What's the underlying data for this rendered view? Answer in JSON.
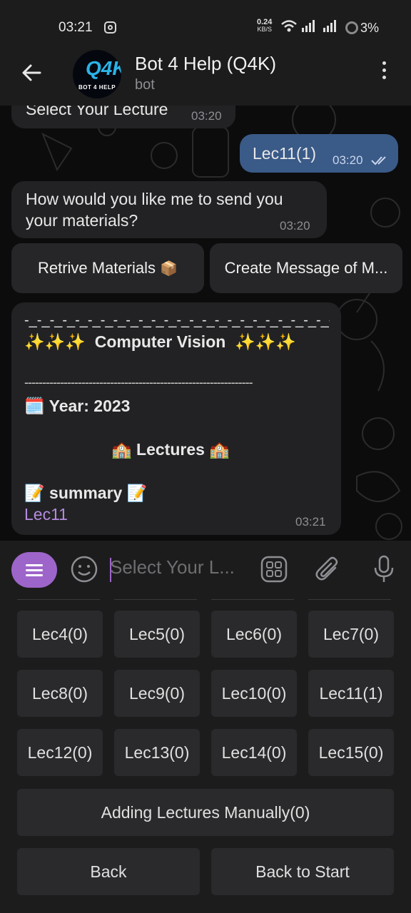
{
  "status_bar": {
    "time": "03:21",
    "speed_value": "0.24",
    "speed_unit": "KB/S",
    "battery": "3%"
  },
  "header": {
    "title": "Bot 4 Help (Q4K)",
    "subtitle": "bot",
    "avatar_logo": "Q4K",
    "avatar_caption": "BOT 4 HELP"
  },
  "messages": [
    {
      "text": "Select Your Lecture",
      "time": "03:20",
      "direction": "in"
    },
    {
      "text": "Lec11(1)",
      "time": "03:20",
      "direction": "out"
    },
    {
      "text": "How would you like me to send you your materials?",
      "time": "03:20",
      "direction": "in"
    }
  ],
  "inline_buttons": [
    {
      "label": "Retrive Materials",
      "emoji": "📦"
    },
    {
      "label": "Create Message of M..."
    }
  ],
  "info_card": {
    "top_line": "-_-_-_-_-_-_-_-_-_-_-_-_-_-_-_-_-_-_-_-_-_-_-_-_-",
    "sparkles": "✨✨✨",
    "subject": "Computer Vision",
    "divider": "----------------------------------------------------------------",
    "year_emoji": "🗓️",
    "year": "Year: 2023",
    "lectures_emoji": "🏫",
    "lectures": "Lectures",
    "summary_emoji": "📝",
    "summary": "summary",
    "link": "Lec11",
    "time": "03:21"
  },
  "input": {
    "placeholder": "Select Your L..."
  },
  "keyboard": {
    "rows": [
      [
        "Lec4(0)",
        "Lec5(0)",
        "Lec6(0)",
        "Lec7(0)"
      ],
      [
        "Lec8(0)",
        "Lec9(0)",
        "Lec10(0)",
        "Lec11(1)"
      ],
      [
        "Lec12(0)",
        "Lec13(0)",
        "Lec14(0)",
        "Lec15(0)"
      ]
    ],
    "manual": "Adding Lectures Manually(0)",
    "back": "Back",
    "back_to_start": "Back to Start"
  },
  "colors": {
    "accent": "#9d65c9",
    "outgoing_bubble": "#3a5a88",
    "incoming_bubble": "#222224",
    "link": "#b48be0"
  },
  "icons": [
    "instagram-icon",
    "wifi-icon",
    "signal-icon",
    "battery-icon",
    "back-arrow-icon",
    "more-vert-icon",
    "menu-icon",
    "emoji-icon",
    "sticker-icon",
    "attach-icon",
    "mic-icon",
    "double-check-icon"
  ]
}
